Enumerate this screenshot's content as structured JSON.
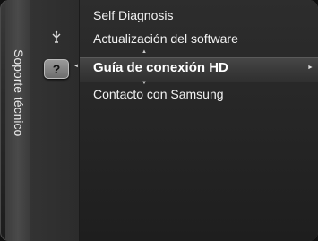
{
  "category": {
    "label": "Soporte técnico"
  },
  "icons": {
    "antenna": "antenna-icon",
    "help": "help-icon",
    "help_glyph": "?"
  },
  "menu": {
    "items": [
      {
        "label": "Self Diagnosis"
      },
      {
        "label": "Actualización del software"
      },
      {
        "label": "Guía de conexión HD",
        "selected": true
      },
      {
        "label": "Contacto con Samsung"
      }
    ]
  },
  "glyphs": {
    "up": "▲",
    "down": "▼",
    "left": "◄",
    "right": "►"
  }
}
